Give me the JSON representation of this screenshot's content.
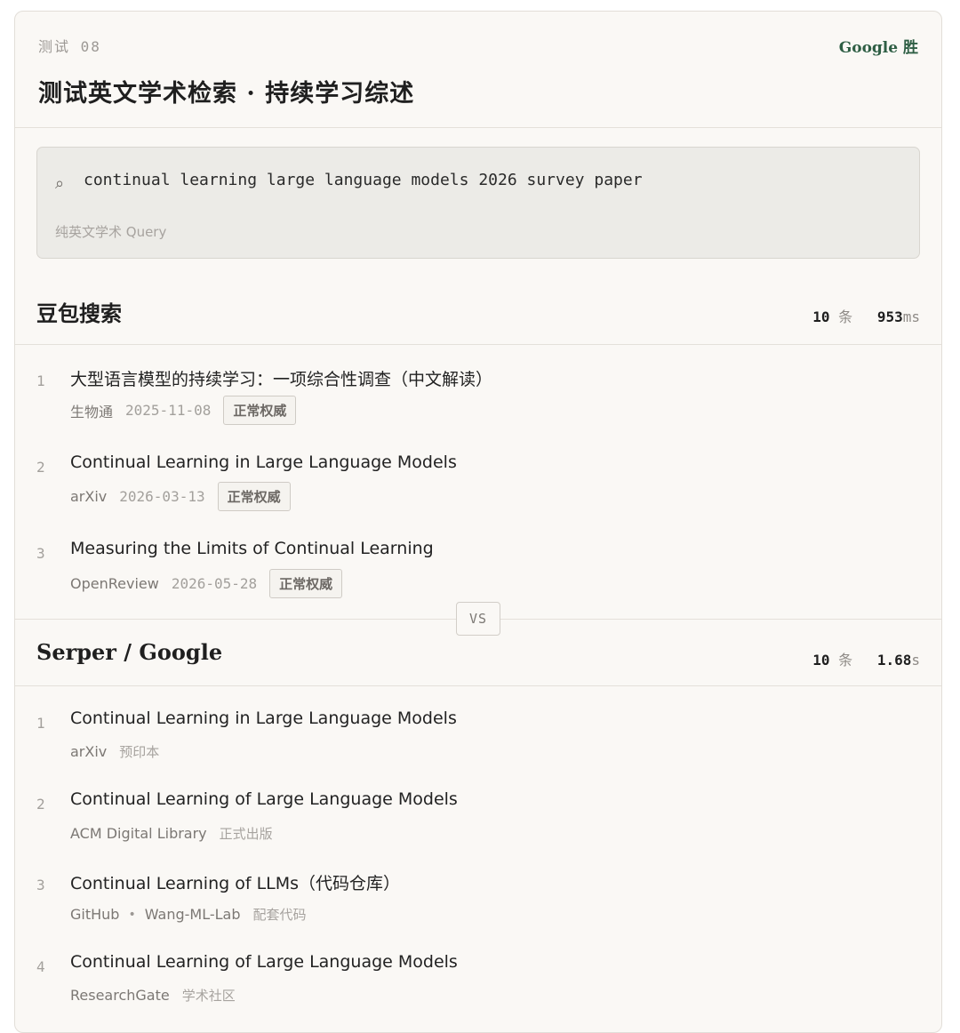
{
  "header": {
    "test_number": "测试 08",
    "winner": "Google 胜",
    "title": "测试英文学术检索 · 持续学习综述"
  },
  "query": {
    "icon": "search-icon",
    "text": "continual learning large language models 2026 survey paper",
    "note": "纯英文学术 Query"
  },
  "doubao": {
    "title": "豆包搜索",
    "count": "10",
    "count_unit": "条",
    "duration": "953",
    "duration_unit": "ms",
    "results": [
      {
        "num": "1",
        "title": "大型语言模型的持续学习：一项综合性调查（中文解读）",
        "source": "生物通",
        "date": "2025-11-08",
        "badge": "正常权威"
      },
      {
        "num": "2",
        "title": "Continual Learning in Large Language Models",
        "source": "arXiv",
        "date": "2026-03-13",
        "badge": "正常权威"
      },
      {
        "num": "3",
        "title": "Measuring the Limits of Continual Learning",
        "source": "OpenReview",
        "date": "2026-05-28",
        "badge": "正常权威"
      }
    ]
  },
  "vs_label": "VS",
  "google": {
    "title": "Serper / Google",
    "count": "10",
    "count_unit": "条",
    "duration": "1.68",
    "duration_unit": "s",
    "results": [
      {
        "num": "1",
        "title": "Continual Learning in Large Language Models",
        "source": "arXiv",
        "note": "预印本"
      },
      {
        "num": "2",
        "title": "Continual Learning of Large Language Models",
        "source": "ACM Digital Library",
        "note": "正式出版"
      },
      {
        "num": "3",
        "title": "Continual Learning of LLMs（代码仓库）",
        "source": "GitHub",
        "sub_source": "Wang-ML-Lab",
        "note": "配套代码"
      },
      {
        "num": "4",
        "title": "Continual Learning of Large Language Models",
        "source": "ResearchGate",
        "note": "学术社区"
      }
    ]
  }
}
